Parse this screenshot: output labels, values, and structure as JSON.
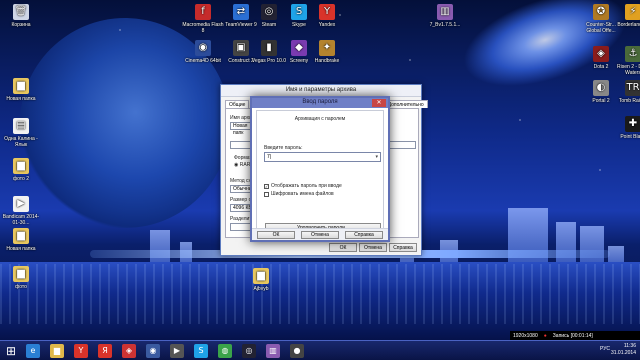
{
  "desktop_icons": [
    {
      "label": "Корзина",
      "icon": "recycle-bin-icon",
      "color": "#cfd6e6",
      "glyph": "🗑"
    },
    {
      "label": "Новая папка",
      "icon": "folder-icon",
      "color": "#e8c760",
      "glyph": "▆"
    },
    {
      "label": "Одна Калина - Ялык",
      "icon": "document-icon",
      "color": "#f2f2f2",
      "glyph": "▤"
    },
    {
      "label": "фото 2",
      "icon": "folder-icon",
      "color": "#e8c760",
      "glyph": "▆"
    },
    {
      "label": "Bandicam 2014-01-30...",
      "icon": "video-file-icon",
      "color": "#f2f2f2",
      "glyph": "▶"
    },
    {
      "label": "Новая папка",
      "icon": "folder-icon",
      "color": "#e8c760",
      "glyph": "▆"
    },
    {
      "label": "фото",
      "icon": "folder-icon",
      "color": "#e8c760",
      "glyph": "▆"
    },
    {
      "label": "Macromedia Flash 8",
      "icon": "flash-icon",
      "color": "#c62b2b",
      "glyph": "f"
    },
    {
      "label": "TeamViewer 9",
      "icon": "teamviewer-icon",
      "color": "#2a6fd4",
      "glyph": "⇄"
    },
    {
      "label": "Steam",
      "icon": "steam-icon",
      "color": "#223",
      "glyph": "◎"
    },
    {
      "label": "Skype",
      "icon": "skype-icon",
      "color": "#1fa3e8",
      "glyph": "S"
    },
    {
      "label": "Yandex",
      "icon": "yandex-icon",
      "color": "#d9332a",
      "glyph": "Y"
    },
    {
      "label": "Cinema4D 64bit",
      "icon": "cinema4d-icon",
      "color": "#2c4c9a",
      "glyph": "◉"
    },
    {
      "label": "Construct 2",
      "icon": "construct-icon",
      "color": "#444",
      "glyph": "▣"
    },
    {
      "label": "Vegas Pro 10.0",
      "icon": "vegas-icon",
      "color": "#333",
      "glyph": "▮"
    },
    {
      "label": "Screeny",
      "icon": "screeny-icon",
      "color": "#7a3bb0",
      "glyph": "◆"
    },
    {
      "label": "Handbrake",
      "icon": "handbrake-icon",
      "color": "#b4832e",
      "glyph": "✦"
    },
    {
      "label": "7_Bv1.7.5.1...",
      "icon": "archive-icon",
      "color": "#8a5bb0",
      "glyph": "▥"
    },
    {
      "label": "Counter-Str... Global Offe...",
      "icon": "csgo-icon",
      "color": "#b07a24",
      "glyph": "✪"
    },
    {
      "label": "Borderlands 2",
      "icon": "borderlands-icon",
      "color": "#e0a020",
      "glyph": "⚡"
    },
    {
      "label": "Dota 2",
      "icon": "dota-icon",
      "color": "#8a1c1c",
      "glyph": "◈"
    },
    {
      "label": "Risen 2 - Dark Waters",
      "icon": "risen-icon",
      "color": "#4a6a3a",
      "glyph": "⚓"
    },
    {
      "label": "Portal 2",
      "icon": "portal-icon",
      "color": "#888",
      "glyph": "◐"
    },
    {
      "label": "Tomb Raider",
      "icon": "tomb-raider-icon",
      "color": "#333",
      "glyph": "TR"
    },
    {
      "label": "Point Blank",
      "icon": "point-blank-icon",
      "color": "#1a1a1a",
      "glyph": "✚"
    },
    {
      "label": "Ajbvyb",
      "icon": "folder-icon",
      "color": "#e8c760",
      "glyph": "▆"
    }
  ],
  "archive_window": {
    "title": "Имя и параметры архива",
    "tabs": [
      "Общие",
      "До",
      "Дополнительно",
      "Архив"
    ],
    "name_label": "Имя архи",
    "name_value": "Новая папк",
    "labels": [
      "Формат",
      "Метод сж",
      "Обычный",
      "Размер сл",
      "4096 КБ",
      "Разделит"
    ],
    "radio_label": "RAR",
    "ok": "ОК",
    "cancel": "Отмена",
    "help": "Справка"
  },
  "password_dialog": {
    "title": "Ввод пароля",
    "heading": "Архивация с паролем",
    "password_label": "Введите пароль:",
    "password_value": "7|",
    "show_password_label": "Отображать пароль при вводе",
    "show_password_checked": true,
    "encrypt_names_label": "Шифровать имена файлов",
    "encrypt_names_checked": false,
    "organize_button": "Упорядочить пароли...",
    "ok": "ОК",
    "cancel": "Отмена",
    "help": "Справка"
  },
  "recorder": {
    "resolution": "1920x1080",
    "status": "Запись [00:01:14]"
  },
  "taskbar": {
    "apps": [
      {
        "name": "ie",
        "glyph": "e",
        "color": "#2a7fd4"
      },
      {
        "name": "explorer",
        "glyph": "▆",
        "color": "#e0b84a"
      },
      {
        "name": "yandex",
        "glyph": "Y",
        "color": "#d9332a"
      },
      {
        "name": "yandex-browser",
        "glyph": "Я",
        "color": "#d9332a"
      },
      {
        "name": "antivirus",
        "glyph": "◈",
        "color": "#c33"
      },
      {
        "name": "cinema",
        "glyph": "◉",
        "color": "#3a5aa0"
      },
      {
        "name": "media",
        "glyph": "▶",
        "color": "#555"
      },
      {
        "name": "skype",
        "glyph": "S",
        "color": "#1fa3e8"
      },
      {
        "name": "chrome",
        "glyph": "◍",
        "color": "#3aa34a"
      },
      {
        "name": "steam",
        "glyph": "◎",
        "color": "#223"
      },
      {
        "name": "winrar",
        "glyph": "▥",
        "color": "#8a5bb0"
      },
      {
        "name": "bandicam",
        "glyph": "●",
        "color": "#444"
      }
    ],
    "language": "РУС",
    "time": "11:36",
    "date": "31.01.2014"
  }
}
